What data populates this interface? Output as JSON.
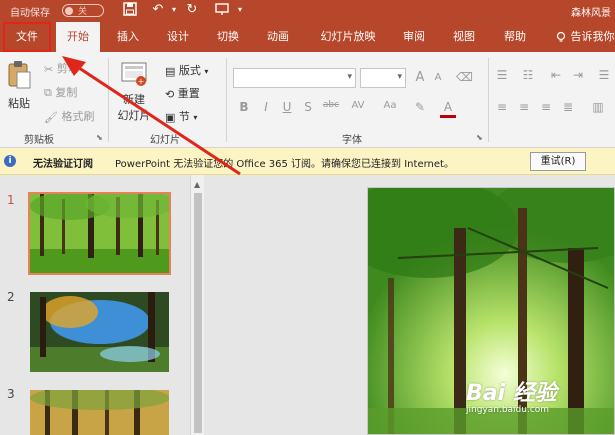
{
  "titlebar": {
    "autosave_label": "自动保存",
    "autosave_state": "关",
    "doc_title": "森林风景"
  },
  "tabs": [
    {
      "label": "文件"
    },
    {
      "label": "开始"
    },
    {
      "label": "插入"
    },
    {
      "label": "设计"
    },
    {
      "label": "切换"
    },
    {
      "label": "动画"
    },
    {
      "label": "幻灯片放映"
    },
    {
      "label": "审阅"
    },
    {
      "label": "视图"
    },
    {
      "label": "帮助"
    }
  ],
  "tell_me": "告诉我你",
  "ribbon": {
    "clipboard": {
      "paste": "粘贴",
      "cut": "剪切",
      "copy": "复制",
      "format_painter": "格式刷",
      "group_label": "剪贴板"
    },
    "slides": {
      "new_slide_line1": "新建",
      "new_slide_line2": "幻灯片",
      "layout": "版式",
      "reset": "重置",
      "section": "节",
      "group_label": "幻灯片"
    },
    "font": {
      "font_name": "",
      "font_size": "",
      "bold": "B",
      "italic": "I",
      "underline": "U",
      "strike": "S",
      "shadow": "abc",
      "spacing": "AV",
      "case": "Aa",
      "grow": "A",
      "shrink": "A",
      "color": "A",
      "group_label": "字体"
    }
  },
  "message_bar": {
    "title": "无法验证订阅",
    "text": "PowerPoint 无法验证您的 Office 365 订阅。请确保您已连接到 Internet。",
    "retry": "重试(R)"
  },
  "slides": [
    {
      "number": "1",
      "selected": true
    },
    {
      "number": "2",
      "selected": false
    },
    {
      "number": "3",
      "selected": false
    }
  ],
  "watermark": {
    "logo": "Bai 经验",
    "url": "jingyan.baidu.com"
  },
  "colors": {
    "brand": "#b7472a",
    "highlight_box": "#e0261b",
    "message_bar": "#fdf4c4"
  }
}
